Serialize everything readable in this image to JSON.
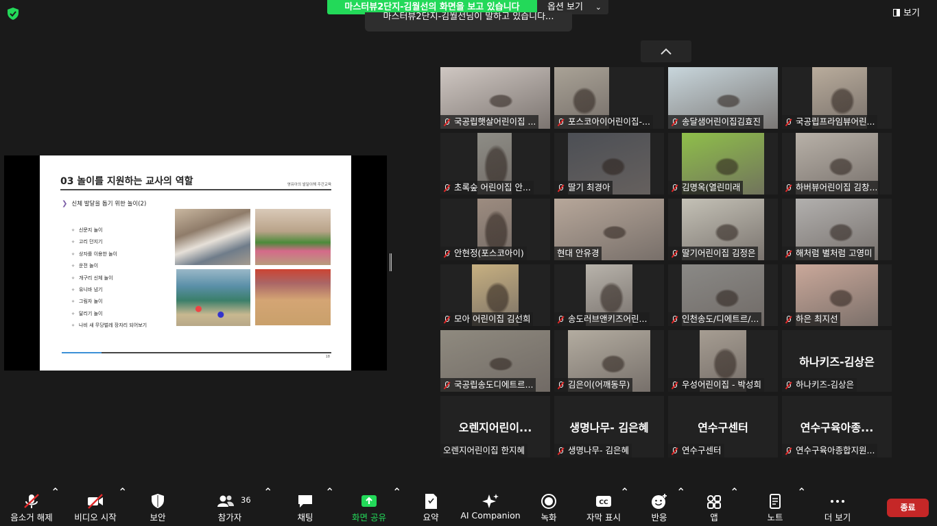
{
  "header": {
    "share_banner": "마스터뷰2단지-김월선의 화면을 보고 있습니다",
    "options_label": "옵션 보기",
    "speaking_notice": "마스터뷰2단지-김월선님이 말하고 있습니다...",
    "view_label": "보기"
  },
  "shared_slide": {
    "title": "03 놀이를 지원하는 교사의 역할",
    "tag": "영유아의 발달이해 주간교육",
    "subtitle": "신체 발달을 돕기 위한 놀이(2)",
    "items": [
      "신문지 놀이",
      "고리 던지기",
      "상자를 이용한 놀이",
      "운전 놀이",
      "개구리 신체 놀이",
      "유니바 넘기",
      "그림자 놀이",
      "달리기 놀이",
      "나비 새 무당벌레 장자리 되어보기"
    ],
    "page_number": "18"
  },
  "participants": [
    {
      "name": "국공립햇살어린이집 ...",
      "video": "#cfc7c2",
      "muted": true
    },
    {
      "name": "포스코아이어린이집-...",
      "video": "#a9a296",
      "muted": true
    },
    {
      "name": "송달샘어린이집김효진",
      "video": "#c8d6dc",
      "muted": true
    },
    {
      "name": "국공립프라임뷰어린...",
      "video": "#b9ac9c",
      "muted": true
    },
    {
      "name": "초록숲 어린이집  안...",
      "video": "#8e8d86",
      "muted": true
    },
    {
      "name": "딸기 최경아",
      "video": "#4c4f55",
      "muted": true
    },
    {
      "name": "김명옥(열린미래",
      "video": "#8fbf4a",
      "muted": true
    },
    {
      "name": "하버뷰어린이집 김창...",
      "video": "#b8b1a8",
      "muted": true
    },
    {
      "name": "안현정(포스코아이)",
      "video": "#9d8c80",
      "muted": true
    },
    {
      "name": "현대 안유경",
      "video": "#b7a79a",
      "muted": false
    },
    {
      "name": "딸기어린이집 김정은",
      "video": "#c4c1b6",
      "muted": true
    },
    {
      "name": "해처럼 별처럼 고영미",
      "video": "#b2b0ae",
      "muted": true
    },
    {
      "name": "모아 어린이집 김선희",
      "video": "#c7b081",
      "muted": true
    },
    {
      "name": "송도러브앤키즈어린...",
      "video": "#b8b3ab",
      "muted": true
    },
    {
      "name": "인천송도/디에트르/...",
      "video": "#8a8986",
      "muted": true
    },
    {
      "name": "하은 최지선",
      "video": "#caa89a",
      "muted": true
    },
    {
      "name": "국공립송도디에트르...",
      "video": "#8f8a7f",
      "muted": true
    },
    {
      "name": "김은이(어깨동무)",
      "video": "#b3aca0",
      "muted": true
    },
    {
      "name": "우성어린이집 - 박성희",
      "video": "#a69d92",
      "muted": true
    },
    {
      "name": "하나키즈-김상은",
      "display": "하나키즈-김상은",
      "muted": true
    },
    {
      "name": "오렌지어린이집 한지혜",
      "display": "오렌지어린이...",
      "muted": false
    },
    {
      "name": "생명나무- 김은혜",
      "display": "생명나무- 김은혜",
      "muted": true
    },
    {
      "name": "연수구센터",
      "display": "연수구센터",
      "muted": true
    },
    {
      "name": "연수구육아종합지원...",
      "display": "연수구육아종...",
      "muted": true
    }
  ],
  "toolbar": {
    "unmute": "음소거 해제",
    "video": "비디오 시작",
    "security": "보안",
    "participants": "참가자",
    "participant_count": "36",
    "chat": "채팅",
    "share": "화면 공유",
    "summary": "요약",
    "ai": "AI Companion",
    "record": "녹화",
    "captions": "자막 표시",
    "reactions": "반응",
    "apps": "앱",
    "notes": "노트",
    "more": "더 보기",
    "end": "종료"
  },
  "colors": {
    "share_green": "#23d959",
    "end_red": "#c52727",
    "muted_red": "#e02828"
  }
}
